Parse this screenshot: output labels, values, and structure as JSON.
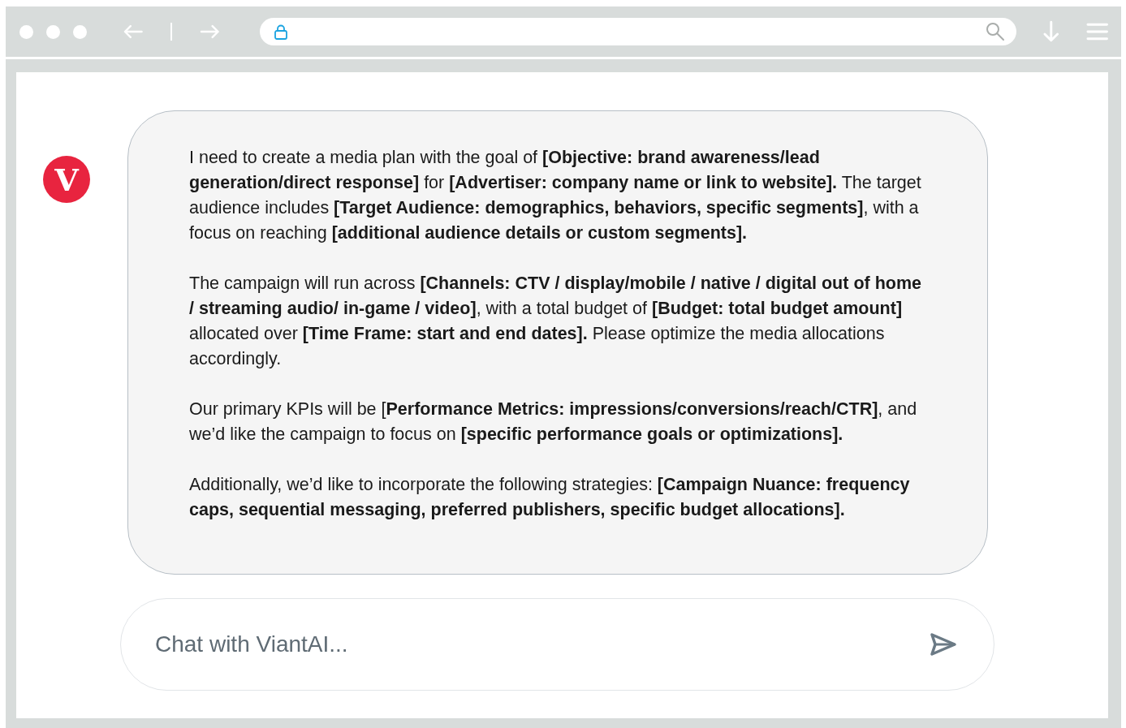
{
  "chat": {
    "avatar": {
      "letter": "V"
    },
    "message": {
      "paragraphs": [
        "I need to create a media plan with the goal of **[Objective: brand awareness/lead generation/direct response]** for **[Advertiser: company name or link to website].** The target audience includes **[Target Audience: demographics, behaviors, specific segments]**, with a focus on reaching **[additional audience details or custom segments].**",
        "The campaign will run across **[Channels: CTV / display/mobile / native / digital out of home / streaming audio/ in-game / video]**, with a total budget of **[Budget: total budget amount]** allocated over **[Time Frame: start and end dates].** Please optimize the media allocations accordingly.",
        "Our primary KPIs will be [**Performance Metrics: impressions/conversions/reach/CTR]**, and we’d like the campaign to focus on **[specific performance goals or optimizations].**",
        "Additionally, we’d like to incorporate the following strategies: **[Campaign Nuance: frequency caps, sequential messaging, preferred publishers, specific budget allocations].**"
      ]
    },
    "input": {
      "placeholder": "Chat with ViantAI..."
    }
  }
}
